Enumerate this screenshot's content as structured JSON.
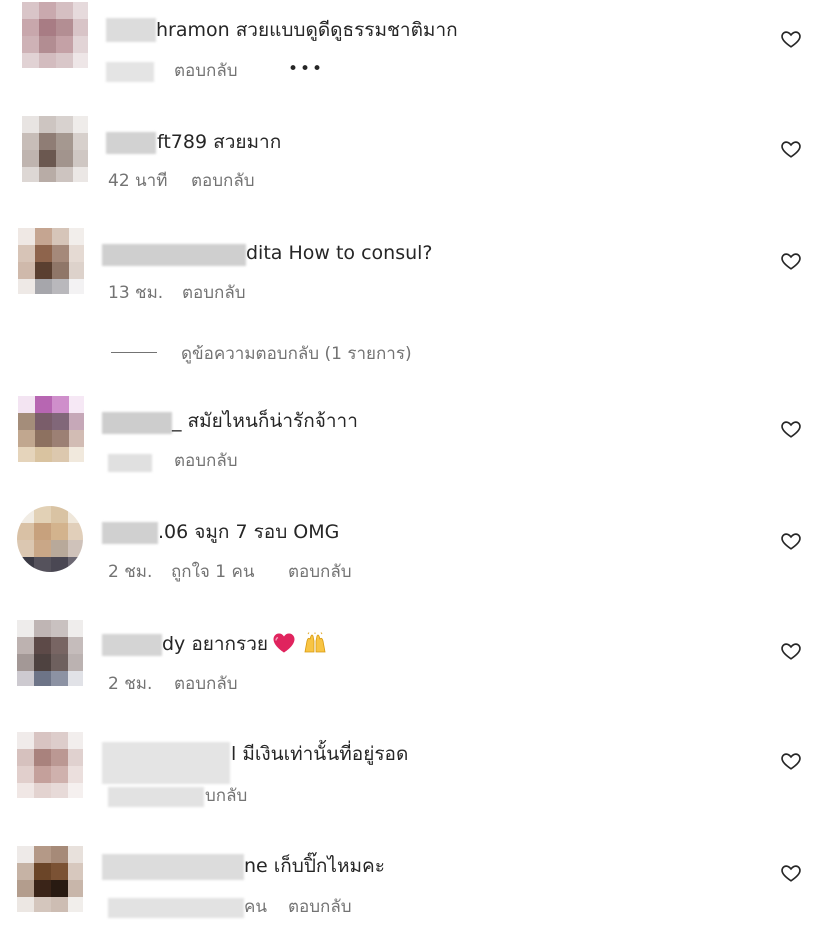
{
  "comments": [
    {
      "text": "hramon สวยแบบดูดีดูธรรมชาติมาก",
      "time": "",
      "likes": "",
      "reply": "ตอบกลับ",
      "more": "•••"
    },
    {
      "text": "ft789 สวยมาก",
      "time": "42 นาที",
      "likes": "",
      "reply": "ตอบกลับ"
    },
    {
      "text": "dita How to consul?",
      "time": "13 ชม.",
      "likes": "",
      "reply": "ตอบกลับ"
    },
    {
      "text": "_ สมัยไหนก็น่ารักจ้าาา",
      "time": "",
      "likes": "",
      "reply": "ตอบกลับ"
    },
    {
      "text": ".06 จมูก 7 รอบ OMG",
      "time": "2 ชม.",
      "likes": "ถูกใจ 1 คน",
      "reply": "ตอบกลับ"
    },
    {
      "text": "dy อยากรวย",
      "time": "2 ชม.",
      "likes": "",
      "reply": "ตอบกลับ",
      "emoji": [
        "heart-emoji",
        "raised-hands-emoji"
      ]
    },
    {
      "text": "l มีเงินเท่านั้นที่อยู่รอด",
      "time": "",
      "likes": "",
      "reply": "บกลับ"
    },
    {
      "text": "ne เก็บปิ๊กไหมคะ",
      "time": "",
      "likes": "คน",
      "reply": "ตอบกลับ"
    }
  ],
  "view_replies": {
    "label": "ดูข้อความตอบกลับ (1 รายการ)"
  },
  "icons": {
    "like": "heart-outline-icon"
  },
  "colors": {
    "text": "#262626",
    "secondary": "#737373",
    "heart_emoji": "#e0245e"
  }
}
